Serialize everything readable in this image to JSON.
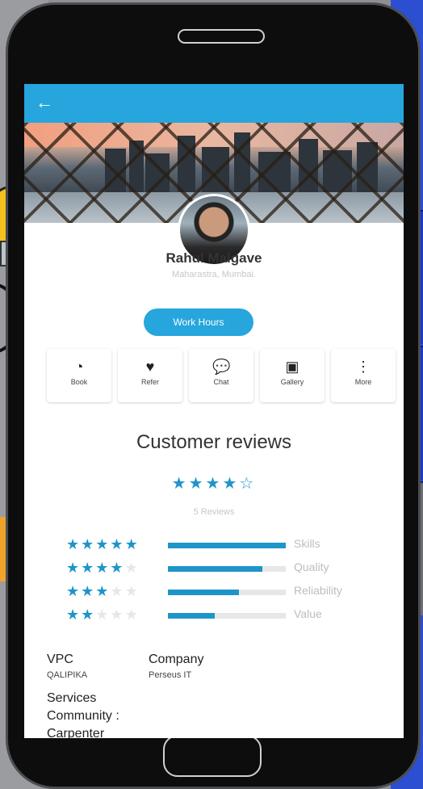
{
  "appbar": {
    "back_icon": "arrow-left-icon"
  },
  "profile": {
    "name": "Rahul Malgave",
    "location": "Maharastra, Mumbai.",
    "work_hours_label": "Work Hours"
  },
  "actions": [
    {
      "label": "Book",
      "icon": "clock-icon"
    },
    {
      "label": "Refer",
      "icon": "heart-icon"
    },
    {
      "label": "Chat",
      "icon": "chat-icon"
    },
    {
      "label": "Gallery",
      "icon": "gallery-icon"
    },
    {
      "label": "More",
      "icon": "more-vert-icon"
    }
  ],
  "reviews": {
    "title": "Customer reviews",
    "overall_rating": 4,
    "max_rating": 5,
    "count_text": "5 Reviews",
    "breakdown": [
      {
        "label": "Skills",
        "stars": 5,
        "fill": 1.0
      },
      {
        "label": "Quality",
        "stars": 4,
        "fill": 0.8
      },
      {
        "label": "Reliability",
        "stars": 3,
        "fill": 0.6
      },
      {
        "label": "Value",
        "stars": 2,
        "fill": 0.4
      }
    ]
  },
  "info": {
    "vpc_label": "VPC",
    "vpc_value": "QALIPIKA",
    "company_label": "Company",
    "company_value": "Perseus IT",
    "services_label": "Services",
    "community_label": "Community :",
    "community_value": "Carpenter"
  },
  "colors": {
    "accent": "#26a6dd",
    "star": "#1e95c9"
  }
}
